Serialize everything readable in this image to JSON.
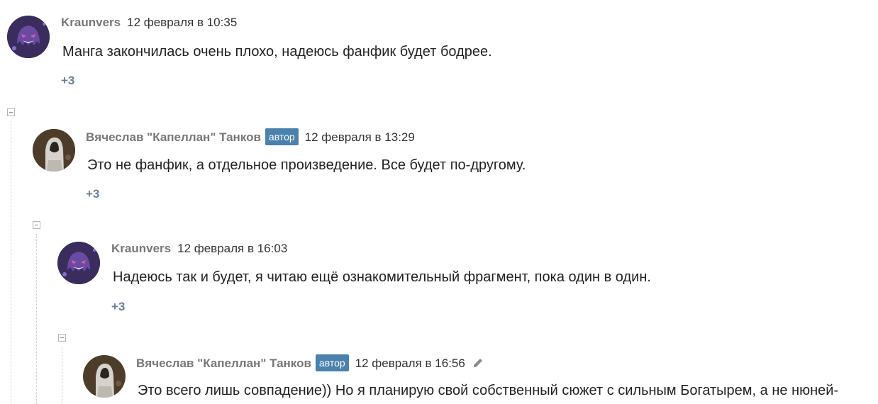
{
  "comments": [
    {
      "author": "Kraunvers",
      "badge": "",
      "date": "12 февраля в 10:35",
      "text": "Манга закончилась очень плохо, надеюсь фанфик будет бодрее.",
      "rating": "+3",
      "avatar": "purple-ghost-avatar"
    },
    {
      "author": "Вячеслав \"Капеллан\" Танков",
      "badge": "автор",
      "date": "12 февраля в 13:29",
      "text": "Это не фанфик, а отдельное произведение. Все будет по-другому.",
      "rating": "+3",
      "avatar": "hooded-figure-avatar"
    },
    {
      "author": "Kraunvers",
      "badge": "",
      "date": "12 февраля в 16:03",
      "text": "Надеюсь так и будет, я читаю ещё ознакомительный фрагмент, пока один в один.",
      "rating": "+3",
      "avatar": "purple-ghost-avatar"
    },
    {
      "author": "Вячеслав \"Капеллан\" Танков",
      "badge": "автор",
      "date": "12 февраля в 16:56",
      "text": "Это всего лишь совпадение)) Но я планирую свой собственный сюжет с сильным Богатырем, а не нюней-",
      "rating": "",
      "avatar": "hooded-figure-avatar",
      "edited_icon": "pencil-icon"
    }
  ],
  "colors": {
    "badge_bg": "#4a81ad",
    "rating": "#6a7f94",
    "author": "#777777"
  }
}
